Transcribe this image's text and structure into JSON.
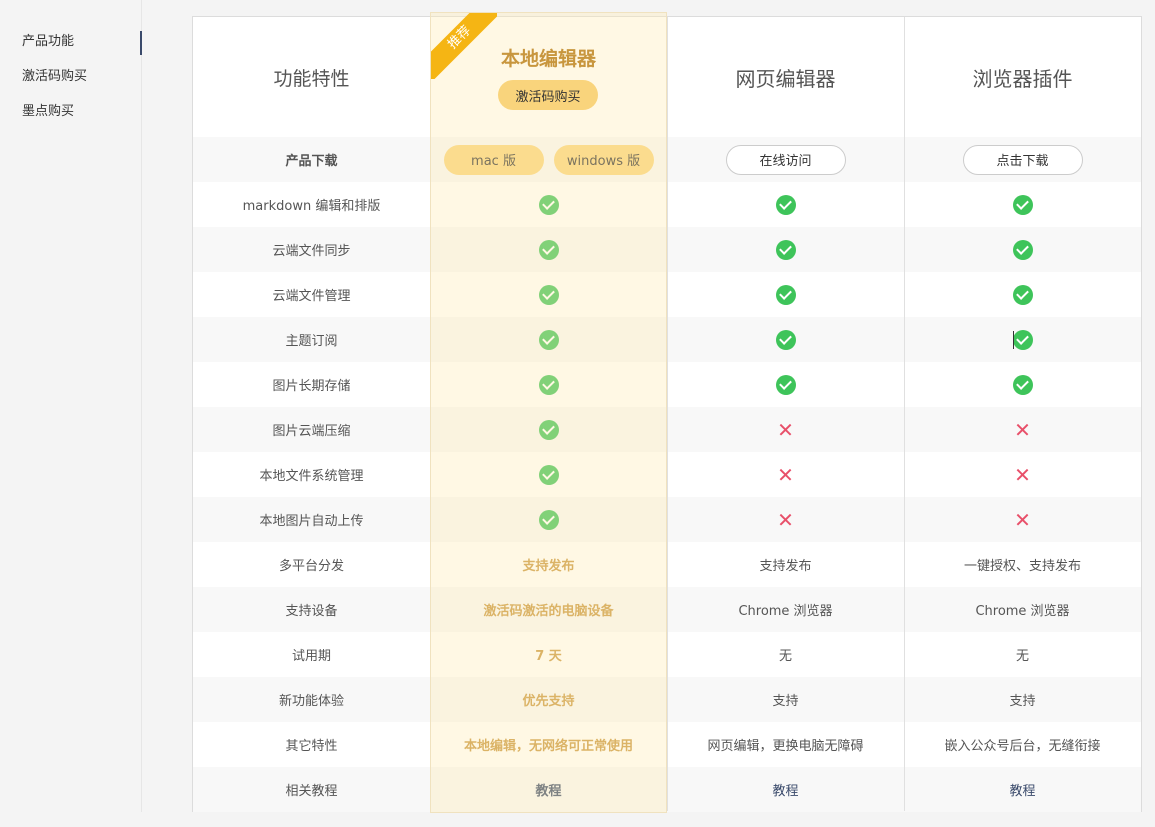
{
  "sidebar": {
    "items": [
      {
        "label": "产品功能"
      },
      {
        "label": "激活码购买"
      },
      {
        "label": "墨点购买"
      }
    ]
  },
  "header": {
    "feature_col": "功能特性",
    "local": {
      "title": "本地编辑器",
      "ribbon": "推荐",
      "buy_button": "激活码购买"
    },
    "web": {
      "title": "网页编辑器"
    },
    "plugin": {
      "title": "浏览器插件"
    }
  },
  "download_row": {
    "label": "产品下载",
    "mac_button": "mac 版",
    "windows_button": "windows 版",
    "web_button": "在线访问",
    "plugin_button": "点击下载"
  },
  "feature_rows": [
    {
      "label": "markdown 编辑和排版",
      "local": "check",
      "web": "check",
      "plugin": "check"
    },
    {
      "label": "云端文件同步",
      "local": "check",
      "web": "check",
      "plugin": "check"
    },
    {
      "label": "云端文件管理",
      "local": "check",
      "web": "check",
      "plugin": "check"
    },
    {
      "label": "主题订阅",
      "local": "check",
      "web": "check",
      "plugin": "check"
    },
    {
      "label": "图片长期存储",
      "local": "check",
      "web": "check",
      "plugin": "check"
    },
    {
      "label": "图片云端压缩",
      "local": "check",
      "web": "cross",
      "plugin": "cross"
    },
    {
      "label": "本地文件系统管理",
      "local": "check",
      "web": "cross",
      "plugin": "cross"
    },
    {
      "label": "本地图片自动上传",
      "local": "check",
      "web": "cross",
      "plugin": "cross"
    }
  ],
  "text_rows": [
    {
      "label": "多平台分发",
      "local": "支持发布",
      "web": "支持发布",
      "plugin": "一键授权、支持发布"
    },
    {
      "label": "支持设备",
      "local": "激活码激活的电脑设备",
      "web": "Chrome 浏览器",
      "plugin": "Chrome 浏览器"
    },
    {
      "label": "试用期",
      "local": "7 天",
      "web": "无",
      "plugin": "无"
    },
    {
      "label": "新功能体验",
      "local": "优先支持",
      "web": "支持",
      "plugin": "支持"
    },
    {
      "label": "其它特性",
      "local": "本地编辑，无网络可正常使用",
      "web": "网页编辑，更换电脑无障碍",
      "plugin": "嵌入公众号后台，无缝衔接"
    }
  ],
  "tutorial_row": {
    "label": "相关教程",
    "local": "教程",
    "web": "教程",
    "plugin": "教程"
  },
  "colors": {
    "accent_gold": "#c8963e",
    "button_gold": "#f9d47c",
    "ribbon": "#f5b514",
    "check_green": "#3ec45a",
    "cross_red": "#e8506a",
    "link_navy": "#3a4a6b"
  }
}
